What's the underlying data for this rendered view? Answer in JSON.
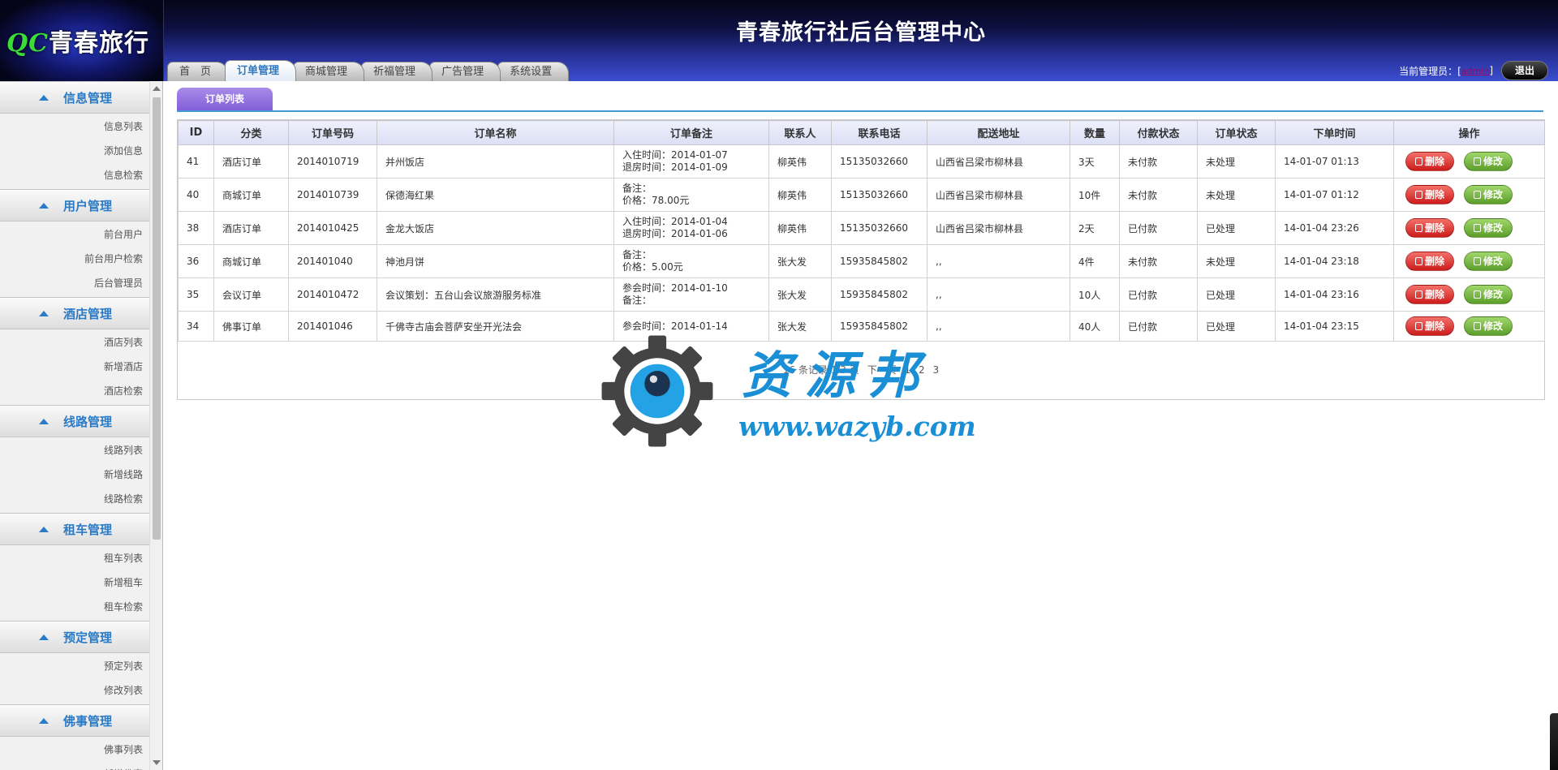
{
  "header": {
    "logo": {
      "prefix": "QC",
      "name": "青春旅行"
    },
    "title": "青春旅行社后台管理中心",
    "tabs": [
      {
        "label": "首　页",
        "active": false
      },
      {
        "label": "订单管理",
        "active": true
      },
      {
        "label": "商城管理",
        "active": false
      },
      {
        "label": "祈福管理",
        "active": false
      },
      {
        "label": "广告管理",
        "active": false
      },
      {
        "label": "系统设置",
        "active": false
      }
    ],
    "admin_label": "当前管理员：[",
    "admin_name": "admin",
    "admin_close": "]",
    "logout_label": "退出"
  },
  "sidebar": {
    "groups": [
      {
        "title": "信息管理",
        "items": [
          "信息列表",
          "添加信息",
          "信息检索"
        ]
      },
      {
        "title": "用户管理",
        "items": [
          "前台用户",
          "前台用户检索",
          "后台管理员"
        ]
      },
      {
        "title": "酒店管理",
        "items": [
          "酒店列表",
          "新增酒店",
          "酒店检索"
        ]
      },
      {
        "title": "线路管理",
        "items": [
          "线路列表",
          "新增线路",
          "线路检索"
        ]
      },
      {
        "title": "租车管理",
        "items": [
          "租车列表",
          "新增租车",
          "租车检索"
        ]
      },
      {
        "title": "预定管理",
        "items": [
          "预定列表",
          "修改列表"
        ]
      },
      {
        "title": "佛事管理",
        "items": [
          "佛事列表",
          "新增佛事"
        ]
      }
    ]
  },
  "main": {
    "subtab_label": "订单列表",
    "columns": [
      "ID",
      "分类",
      "订单号码",
      "订单名称",
      "订单备注",
      "联系人",
      "联系电话",
      "配送地址",
      "数量",
      "付款状态",
      "订单状态",
      "下单时间",
      "操作"
    ],
    "rows": [
      {
        "id": "41",
        "category": "酒店订单",
        "order_no": "2014010719",
        "name": "并州饭店",
        "note": [
          "入住时间：2014-01-07",
          "退房时间：2014-01-09"
        ],
        "contact": "柳英伟",
        "phone": "15135032660",
        "address": "山西省吕梁市柳林县",
        "qty": "3天",
        "pay_status": "未付款",
        "order_status": "未处理",
        "time": "14-01-07 01:13"
      },
      {
        "id": "40",
        "category": "商城订单",
        "order_no": "2014010739",
        "name": "保德海红果",
        "note": [
          "备注：",
          "价格：78.00元"
        ],
        "contact": "柳英伟",
        "phone": "15135032660",
        "address": "山西省吕梁市柳林县",
        "qty": "10件",
        "pay_status": "未付款",
        "order_status": "未处理",
        "time": "14-01-07 01:12"
      },
      {
        "id": "38",
        "category": "酒店订单",
        "order_no": "2014010425",
        "name": "金龙大饭店",
        "note": [
          "入住时间：2014-01-04",
          "退房时间：2014-01-06"
        ],
        "contact": "柳英伟",
        "phone": "15135032660",
        "address": "山西省吕梁市柳林县",
        "qty": "2天",
        "pay_status": "已付款",
        "order_status": "已处理",
        "time": "14-01-04 23:26"
      },
      {
        "id": "36",
        "category": "商城订单",
        "order_no": "201401040",
        "name": "神池月饼",
        "note": [
          "备注：",
          "价格：5.00元"
        ],
        "contact": "张大发",
        "phone": "15935845802",
        "address": ",,",
        "qty": "4件",
        "pay_status": "未付款",
        "order_status": "未处理",
        "time": "14-01-04 23:18"
      },
      {
        "id": "35",
        "category": "会议订单",
        "order_no": "2014010472",
        "name": "会议策划：五台山会议旅游服务标准",
        "note": [
          "参会时间：2014-01-10",
          "备注："
        ],
        "contact": "张大发",
        "phone": "15935845802",
        "address": ",,",
        "qty": "10人",
        "pay_status": "已付款",
        "order_status": "已处理",
        "time": "14-01-04 23:16"
      },
      {
        "id": "34",
        "category": "佛事订单",
        "order_no": "201401046",
        "name": "千佛寺古庙会菩萨安坐开光法会",
        "note": [
          "参会时间：2014-01-14"
        ],
        "contact": "张大发",
        "phone": "15935845802",
        "address": ",,",
        "qty": "40人",
        "pay_status": "已付款",
        "order_status": "已处理",
        "time": "14-01-04 23:15"
      }
    ],
    "delete_label": "删除",
    "edit_label": "修改",
    "pager": {
      "summary": "16 条记录 1/3 页",
      "next": "下一页",
      "pages": [
        "1",
        "2",
        "3"
      ]
    }
  },
  "watermark": {
    "title": "资源邦",
    "url": "www.wazyb.com"
  },
  "colors": {
    "accent": "#2e79c2",
    "sidebar_title": "#2a7bc7",
    "subtab": "#8c6ce0",
    "delete_button": "#d9262c",
    "edit_button": "#6aaa35",
    "watermark": "#1b8fd6"
  }
}
